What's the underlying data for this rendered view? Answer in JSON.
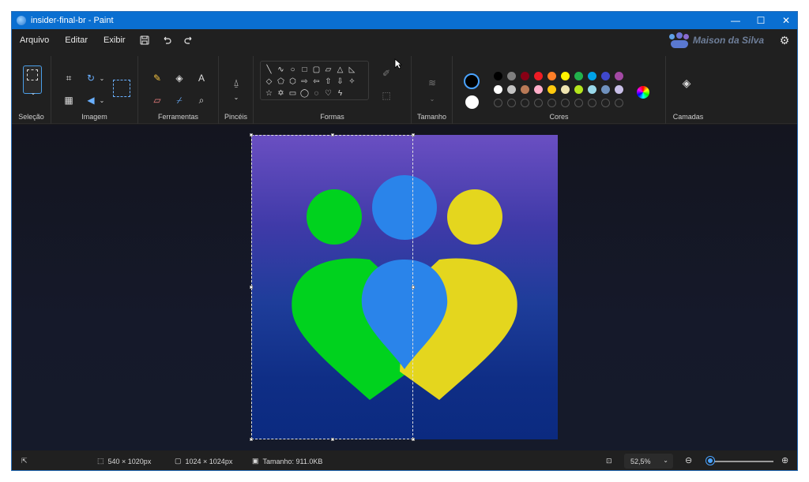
{
  "window": {
    "title": "insider-final-br - Paint",
    "controls": {
      "minimize": "—",
      "maximize": "☐",
      "close": "✕"
    }
  },
  "menu": {
    "items": [
      "Arquivo",
      "Editar",
      "Exibir"
    ],
    "icons": [
      "save-icon",
      "undo-icon",
      "redo-icon"
    ],
    "brand": "Maison da Silva"
  },
  "ribbon": {
    "groups": {
      "selecao": "Seleção",
      "imagem": "Imagem",
      "ferramentas": "Ferramentas",
      "pinceis": "Pincéis",
      "formas": "Formas",
      "tamanho": "Tamanho",
      "cores": "Cores",
      "camadas": "Camadas"
    },
    "colors": {
      "current_primary": "#000000",
      "current_secondary": "#ffffff",
      "row1": [
        "#000000",
        "#7f7f7f",
        "#880015",
        "#ed1c24",
        "#ff7f27",
        "#fff200",
        "#22b14c",
        "#00a2e8",
        "#3f48cc",
        "#a349a4"
      ],
      "row2": [
        "#ffffff",
        "#c3c3c3",
        "#b97a57",
        "#ffaec9",
        "#ffc90e",
        "#efe4b0",
        "#b5e61d",
        "#99d9ea",
        "#7092be",
        "#c8bfe7"
      ]
    }
  },
  "canvas": {
    "image_colors": {
      "green": "#00d21e",
      "blue": "#2a84ea",
      "yellow": "#e4d61e"
    }
  },
  "status": {
    "selection_size": "540 × 1020px",
    "image_size": "1024 × 1024px",
    "file_size": "Tamanho: 911.0KB",
    "zoom": "52,5%"
  }
}
